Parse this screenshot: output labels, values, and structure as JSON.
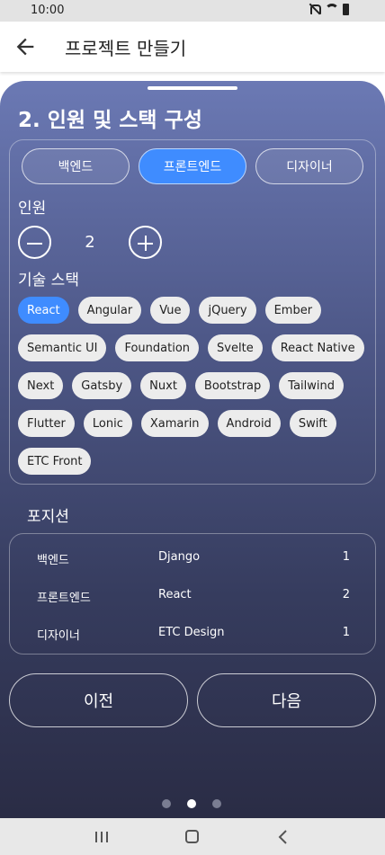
{
  "status_bar": {
    "time": "10:00"
  },
  "app_bar": {
    "title": "프로젝트 만들기"
  },
  "form": {
    "section_title": "2. 인원 및 스택 구성",
    "tabs": [
      {
        "label": "백엔드",
        "active": false
      },
      {
        "label": "프론트엔드",
        "active": true
      },
      {
        "label": "디자이너",
        "active": false
      }
    ],
    "headcount_label": "인원",
    "headcount_value": "2",
    "stack_label": "기술 스택",
    "chips": [
      {
        "label": "React",
        "selected": true
      },
      {
        "label": "Angular",
        "selected": false
      },
      {
        "label": "Vue",
        "selected": false
      },
      {
        "label": "jQuery",
        "selected": false
      },
      {
        "label": "Ember",
        "selected": false
      },
      {
        "label": "Semantic UI",
        "selected": false
      },
      {
        "label": "Foundation",
        "selected": false
      },
      {
        "label": "Svelte",
        "selected": false
      },
      {
        "label": "React Native",
        "selected": false
      },
      {
        "label": "Next",
        "selected": false
      },
      {
        "label": "Gatsby",
        "selected": false
      },
      {
        "label": "Nuxt",
        "selected": false
      },
      {
        "label": "Bootstrap",
        "selected": false
      },
      {
        "label": "Tailwind",
        "selected": false
      },
      {
        "label": "Flutter",
        "selected": false
      },
      {
        "label": "Lonic",
        "selected": false
      },
      {
        "label": "Xamarin",
        "selected": false
      },
      {
        "label": "Android",
        "selected": false
      },
      {
        "label": "Swift",
        "selected": false
      },
      {
        "label": "ETC Front",
        "selected": false
      }
    ]
  },
  "positions": {
    "title": "포지션",
    "rows": [
      {
        "role": "백엔드",
        "stack": "Django",
        "count": "1"
      },
      {
        "role": "프론트엔드",
        "stack": "React",
        "count": "2"
      },
      {
        "role": "디자이너",
        "stack": "ETC Design",
        "count": "1"
      }
    ]
  },
  "buttons": {
    "prev": "이전",
    "next": "다음"
  },
  "pager": {
    "total": 3,
    "current_index": 1
  },
  "colors": {
    "accent": "#3f8cff",
    "chip_bg": "#ececec",
    "sheet_top": "#6b79b4",
    "sheet_bottom": "#2a2c45"
  }
}
